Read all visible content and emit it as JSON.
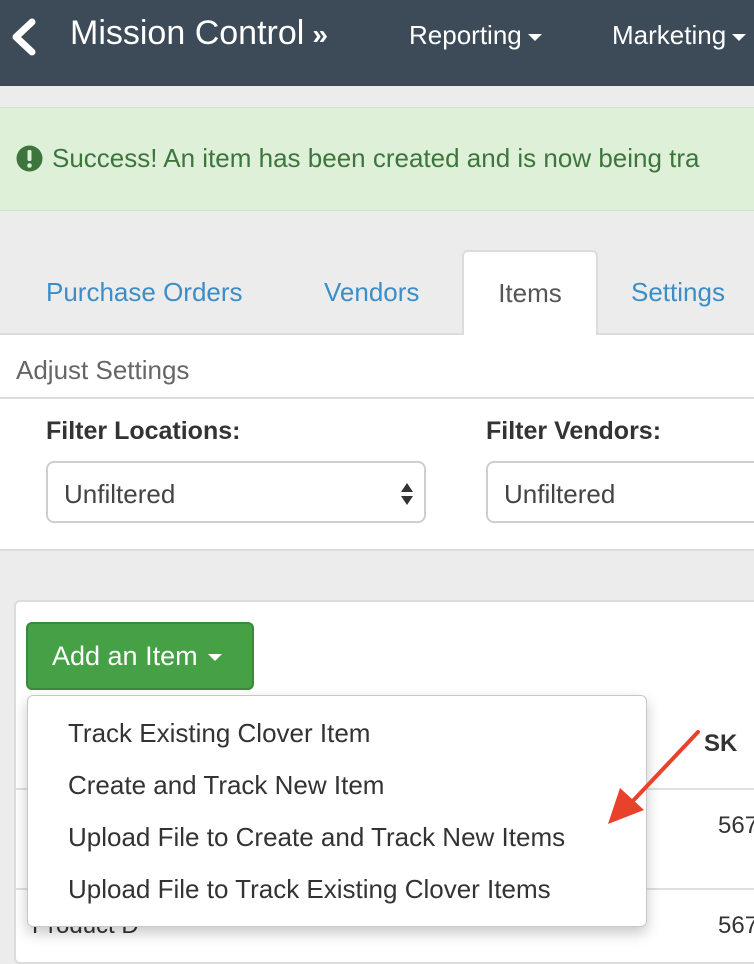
{
  "topbar": {
    "title": "Mission Control",
    "title_chevron": "»",
    "nav": [
      {
        "label": "Reporting"
      },
      {
        "label": "Marketing"
      }
    ],
    "back_icon": "chevron-left-icon"
  },
  "alert": {
    "icon": "exclamation-circle-icon",
    "text": "Success! An item has been created and is now being tra"
  },
  "tabs": [
    {
      "label": "Purchase Orders",
      "active": false
    },
    {
      "label": "Vendors",
      "active": false
    },
    {
      "label": "Items",
      "active": true
    },
    {
      "label": "Settings",
      "active": false
    }
  ],
  "settings_panel": {
    "heading": "Adjust Settings",
    "filter_locations": {
      "label": "Filter Locations:",
      "value": "Unfiltered"
    },
    "filter_vendors": {
      "label": "Filter Vendors:",
      "value": "Unfiltered"
    }
  },
  "items": {
    "add_button_label": "Add an Item",
    "menu": [
      {
        "label": "Track Existing Clover Item"
      },
      {
        "label": "Create and Track New Item"
      },
      {
        "label": "Upload File to Create and Track New Items"
      },
      {
        "label": "Upload File to Track Existing Clover Items"
      }
    ],
    "table": {
      "sku_header": "SK",
      "rows": [
        {
          "name": "",
          "sku": "567"
        },
        {
          "name": "Product D",
          "sku": "567"
        }
      ]
    }
  },
  "colors": {
    "topbar": "#3d4a57",
    "success_bg": "#dff0d8",
    "success_text": "#3c763d",
    "link": "#3b8ec8",
    "button_green": "#45a046",
    "annotation_arrow": "#e8412c"
  }
}
